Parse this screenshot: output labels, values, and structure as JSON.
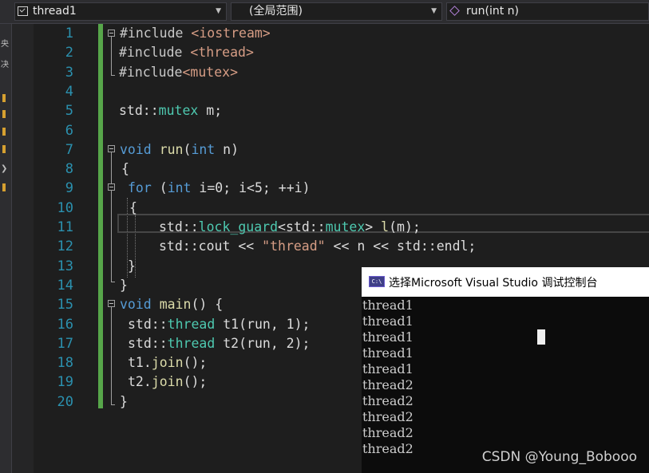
{
  "navbar": {
    "project": {
      "label": "thread1",
      "icon": "project-icon"
    },
    "scope": {
      "label": "(全局范围)"
    },
    "member": {
      "label": "run(int n)",
      "icon": "method-cube-icon"
    },
    "dropdown_icon": "chevron-down-icon"
  },
  "left_strip": {
    "chars": [
      "央",
      "决"
    ]
  },
  "editor": {
    "line_numbers": [
      "1",
      "2",
      "3",
      "4",
      "5",
      "6",
      "7",
      "8",
      "9",
      "10",
      "11",
      "12",
      "13",
      "14",
      "15",
      "16",
      "17",
      "18",
      "19",
      "20"
    ],
    "colors": {
      "keyword": "#569cd6",
      "type": "#4ec9b0",
      "function": "#dcdcaa",
      "string": "#d69d85",
      "line_number": "#2b91af",
      "change_bar": "#57a64a"
    },
    "tokens": {
      "l1": {
        "a": "#include ",
        "b": "<iostream>"
      },
      "l2": {
        "a": "#include ",
        "b": "<thread>"
      },
      "l3": {
        "a": "#include",
        "b": "<mutex>"
      },
      "l5": {
        "a": "std::",
        "b": "mutex",
        "c": " m;"
      },
      "l7": {
        "a": "void",
        "b": " ",
        "c": "run",
        "d": "(",
        "e": "int",
        "f": " n)"
      },
      "l8": {
        "a": "{"
      },
      "l9": {
        "a": "for",
        "b": " (",
        "c": "int",
        "d": " i=0; i<5; ++i)"
      },
      "l10": {
        "a": "{"
      },
      "l11": {
        "a": "std::",
        "b": "lock_guard",
        "c": "<std::",
        "d": "mutex",
        "e": "> ",
        "f": "l",
        "g": "(m);"
      },
      "l12": {
        "a": "std::cout << ",
        "b": "\"thread\"",
        "c": " << n << std::endl;"
      },
      "l13": {
        "a": "}"
      },
      "l14": {
        "a": "}"
      },
      "l15": {
        "a": "void",
        "b": " ",
        "c": "main",
        "d": "() {"
      },
      "l16": {
        "a": "std::",
        "b": "thread",
        "c": " t1(run, 1);"
      },
      "l17": {
        "a": "std::",
        "b": "thread",
        "c": " t2(run, 2);"
      },
      "l18": {
        "a": "t1.",
        "b": "join",
        "c": "();"
      },
      "l19": {
        "a": "t2.",
        "b": "join",
        "c": "();"
      },
      "l20": {
        "a": "}"
      }
    }
  },
  "console": {
    "title": "选择Microsoft Visual Studio 调试控制台",
    "icon_text": "C:\\",
    "output": [
      "thread1",
      "thread1",
      "thread1",
      "thread1",
      "thread1",
      "thread2",
      "thread2",
      "thread2",
      "thread2",
      "thread2"
    ]
  },
  "watermark": "CSDN @Young_Bobooo"
}
